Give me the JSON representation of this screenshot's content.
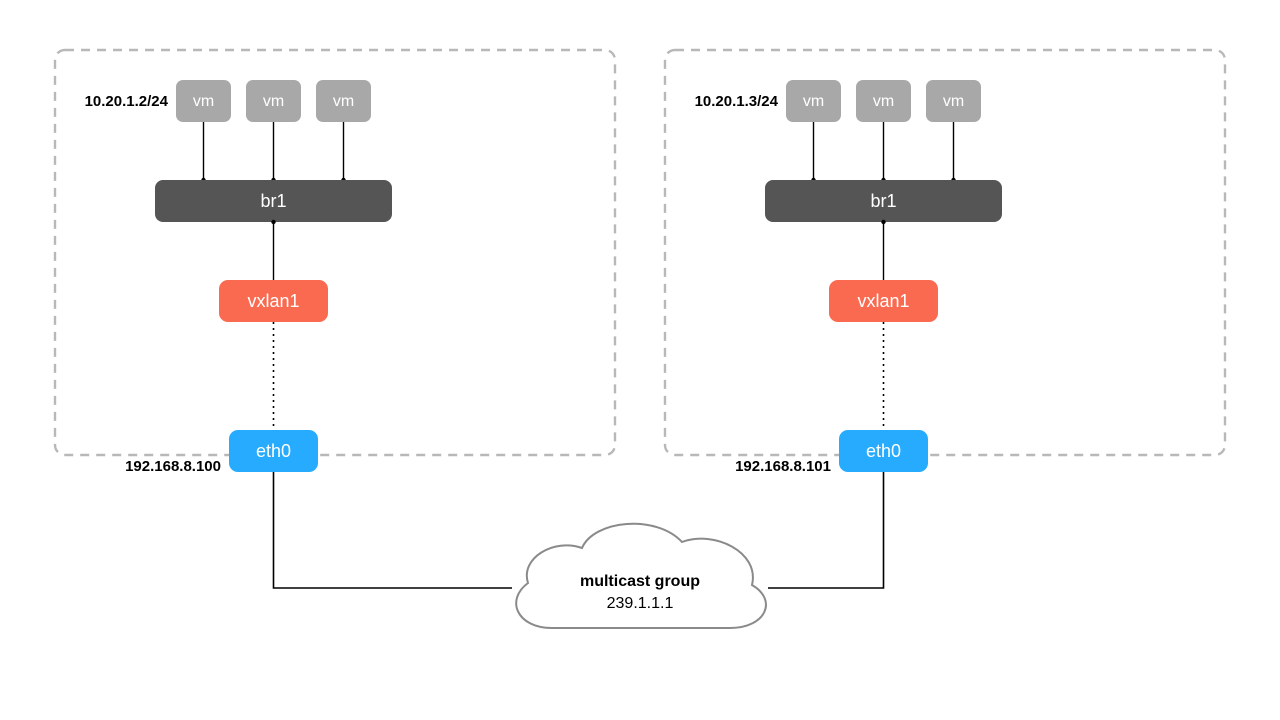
{
  "left": {
    "vm_ip": "10.20.1.2/24",
    "vms": [
      "vm",
      "vm",
      "vm"
    ],
    "bridge": "br1",
    "vxlan": "vxlan1",
    "eth": "eth0",
    "eth_ip": "192.168.8.100"
  },
  "right": {
    "vm_ip": "10.20.1.3/24",
    "vms": [
      "vm",
      "vm",
      "vm"
    ],
    "bridge": "br1",
    "vxlan": "vxlan1",
    "eth": "eth0",
    "eth_ip": "192.168.8.101"
  },
  "cloud": {
    "title": "multicast group",
    "ip": "239.1.1.1"
  },
  "colors": {
    "vm": "#a8a8a8",
    "bridge": "#555555",
    "vxlan": "#f96a50",
    "eth": "#27abff",
    "dashed_border": "#b8b8b8",
    "cloud_stroke": "#8a8a8a"
  }
}
